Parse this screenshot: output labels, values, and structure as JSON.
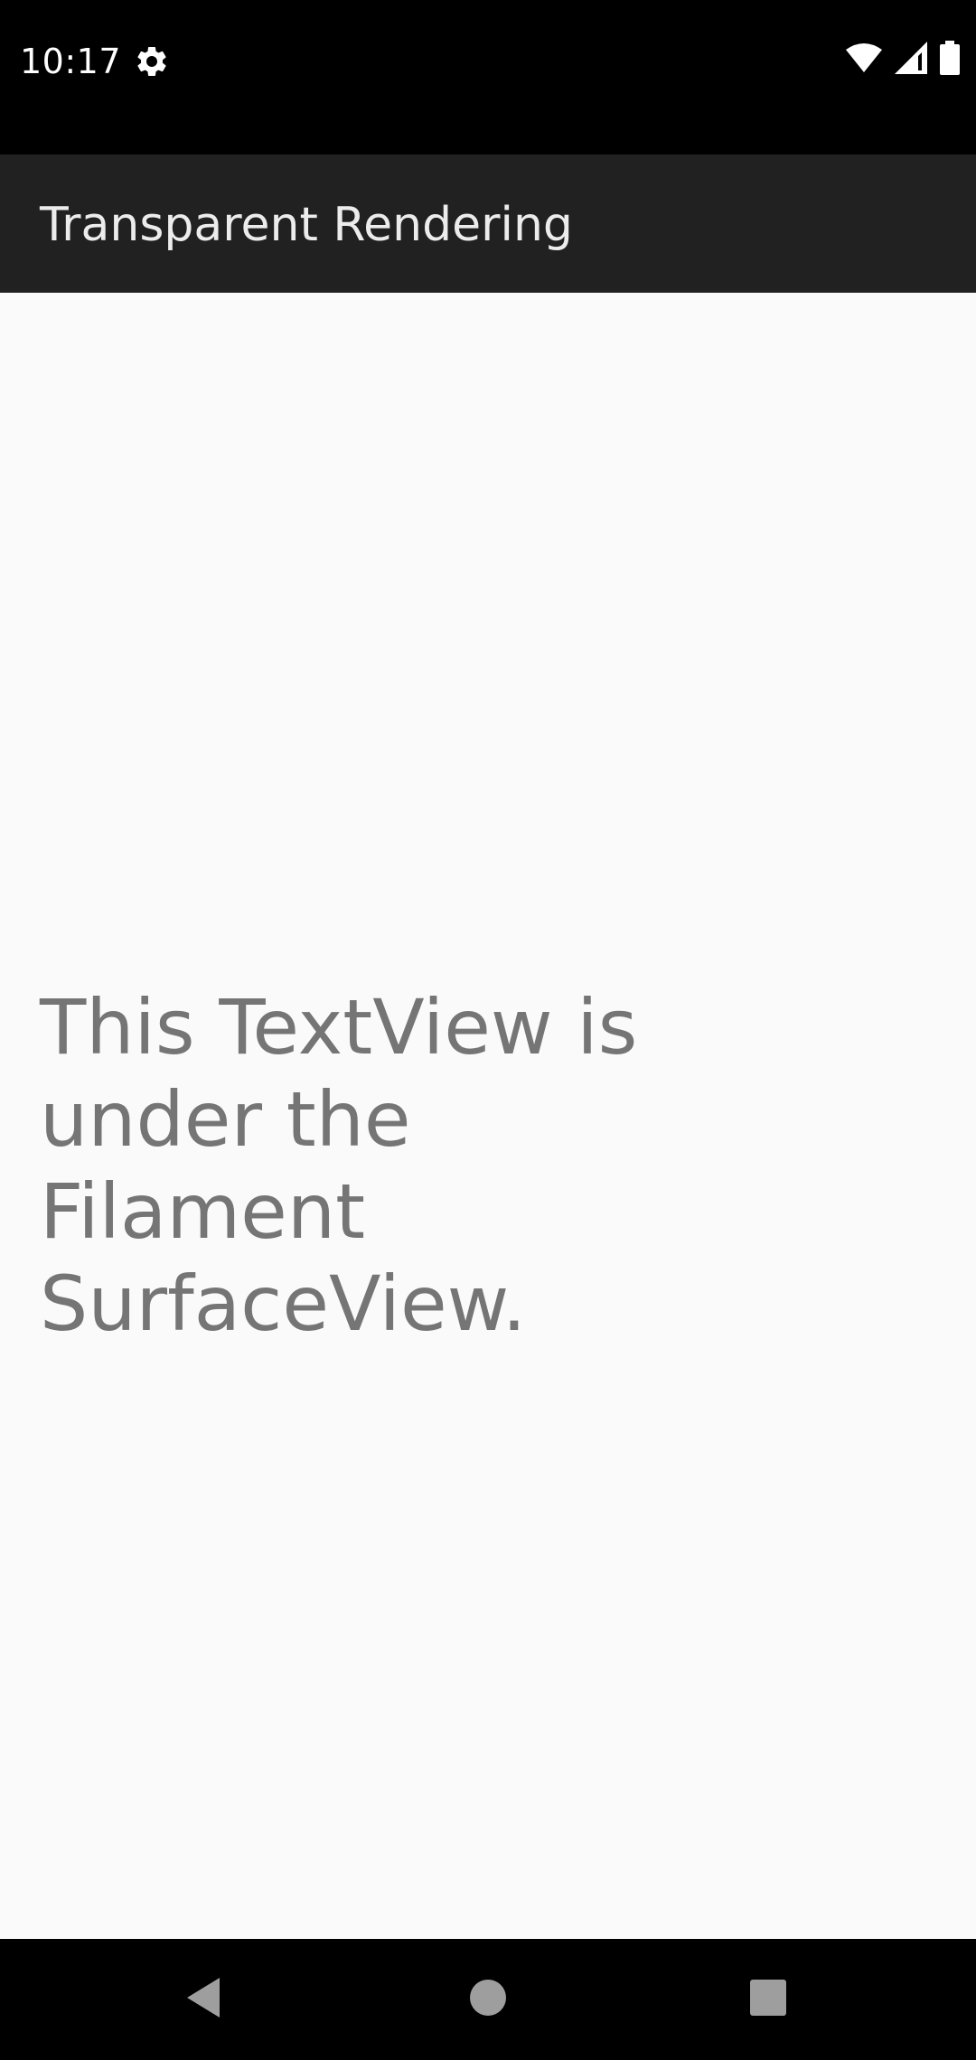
{
  "status_bar": {
    "time": "10:17",
    "icons": [
      "gear-icon",
      "wifi-icon",
      "cell-signal-icon",
      "battery-icon"
    ]
  },
  "app_bar": {
    "title": "Transparent Rendering"
  },
  "content": {
    "text": "This TextView is under the Filament SurfaceView."
  },
  "nav_bar": {
    "icons": [
      "back-icon",
      "home-icon",
      "recents-icon"
    ]
  },
  "colors": {
    "status_bar_bg": "#000000",
    "app_bar_bg": "#212121",
    "app_bar_text": "#ececec",
    "content_bg": "#fafafa",
    "content_text": "#757575",
    "nav_icon": "#9e9e9e"
  }
}
